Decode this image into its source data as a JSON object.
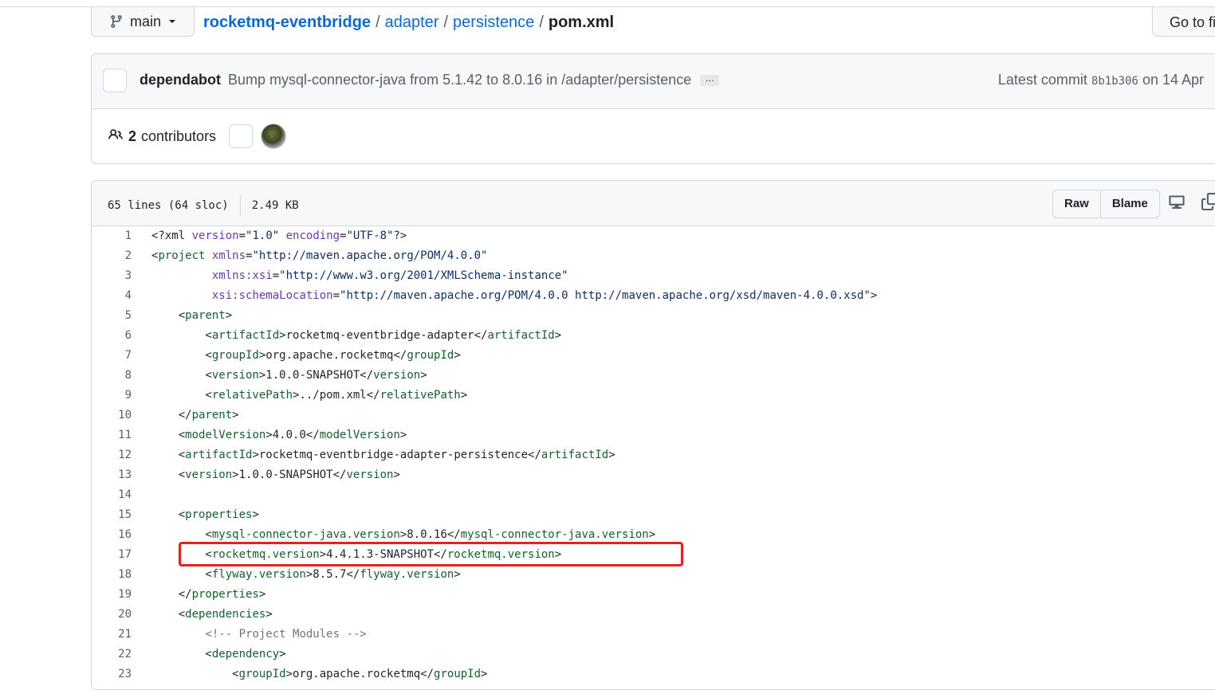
{
  "header": {
    "branch": "main",
    "breadcrumbs": [
      {
        "label": "rocketmq-eventbridge",
        "link": true
      },
      {
        "label": "adapter",
        "link": true
      },
      {
        "label": "persistence",
        "link": true
      }
    ],
    "separator": "/",
    "file_name": "pom.xml",
    "go_to_file": "Go to file"
  },
  "commit": {
    "author": "dependabot",
    "message": "Bump mysql-connector-java from 5.1.42 to 8.0.16 in /adapter/persistence",
    "ellipsis": "…",
    "latest_prefix": "Latest commit",
    "sha": "8b1b306",
    "date_text": "on 14 Apr"
  },
  "contributors": {
    "count": "2",
    "label": "contributors"
  },
  "file": {
    "lines_info": "65 lines (64 sloc)",
    "size": "2.49 KB",
    "raw_label": "Raw",
    "blame_label": "Blame",
    "icons": [
      "display-icon",
      "copy-icon"
    ]
  },
  "code_lines": [
    {
      "n": "1",
      "text": "<?xml version=\"1.0\" encoding=\"UTF-8\"?>"
    },
    {
      "n": "2",
      "text": "<project xmlns=\"http://maven.apache.org/POM/4.0.0\""
    },
    {
      "n": "3",
      "text": "         xmlns:xsi=\"http://www.w3.org/2001/XMLSchema-instance\""
    },
    {
      "n": "4",
      "text": "         xsi:schemaLocation=\"http://maven.apache.org/POM/4.0.0 http://maven.apache.org/xsd/maven-4.0.0.xsd\">"
    },
    {
      "n": "5",
      "text": "    <parent>"
    },
    {
      "n": "6",
      "text": "        <artifactId>rocketmq-eventbridge-adapter</artifactId>"
    },
    {
      "n": "7",
      "text": "        <groupId>org.apache.rocketmq</groupId>"
    },
    {
      "n": "8",
      "text": "        <version>1.0.0-SNAPSHOT</version>"
    },
    {
      "n": "9",
      "text": "        <relativePath>../pom.xml</relativePath>"
    },
    {
      "n": "10",
      "text": "    </parent>"
    },
    {
      "n": "11",
      "text": "    <modelVersion>4.0.0</modelVersion>"
    },
    {
      "n": "12",
      "text": "    <artifactId>rocketmq-eventbridge-adapter-persistence</artifactId>"
    },
    {
      "n": "13",
      "text": "    <version>1.0.0-SNAPSHOT</version>"
    },
    {
      "n": "14",
      "text": ""
    },
    {
      "n": "15",
      "text": "    <properties>"
    },
    {
      "n": "16",
      "text": "        <mysql-connector-java.version>8.0.16</mysql-connector-java.version>"
    },
    {
      "n": "17",
      "text": "        <rocketmq.version>4.4.1.3-SNAPSHOT</rocketmq.version>"
    },
    {
      "n": "18",
      "text": "        <flyway.version>8.5.7</flyway.version>"
    },
    {
      "n": "19",
      "text": "    </properties>"
    },
    {
      "n": "20",
      "text": "    <dependencies>"
    },
    {
      "n": "21",
      "text": "        <!-- Project Modules -->"
    },
    {
      "n": "22",
      "text": "        <dependency>"
    },
    {
      "n": "23",
      "text": "            <groupId>org.apache.rocketmq</groupId>"
    }
  ],
  "highlight": {
    "line": "17",
    "color": "#e32222"
  },
  "colors": {
    "link": "#0969da",
    "tag": "#116329",
    "attr": "#6639ba",
    "string": "#0a3069",
    "comment": "#6e7781"
  }
}
